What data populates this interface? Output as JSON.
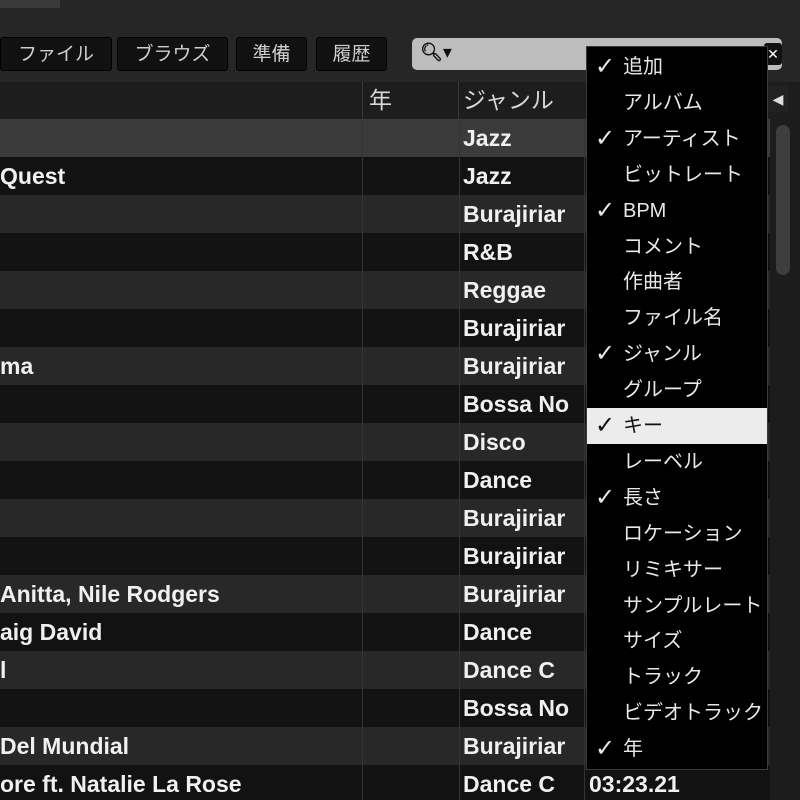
{
  "toolbar": {
    "buttons": [
      "ファイル",
      "ブラウズ",
      "準備",
      "履歴"
    ],
    "search": {
      "icon": "search-icon",
      "value": ""
    }
  },
  "columns": {
    "year": "年",
    "genre": "ジャンル"
  },
  "rows": [
    {
      "title": "",
      "genre": "Jazz",
      "length": ""
    },
    {
      "title": "Quest",
      "genre": "Jazz",
      "length": ""
    },
    {
      "title": "",
      "genre": "Burajiriar",
      "length": ""
    },
    {
      "title": "",
      "genre": "R&B",
      "length": ""
    },
    {
      "title": "",
      "genre": "Reggae",
      "length": ""
    },
    {
      "title": "",
      "genre": "Burajiriar",
      "length": ""
    },
    {
      "title": "ma",
      "genre": "Burajiriar",
      "length": ""
    },
    {
      "title": "",
      "genre": "Bossa No",
      "length": ""
    },
    {
      "title": "",
      "genre": "Disco",
      "length": ""
    },
    {
      "title": "",
      "genre": "Dance",
      "length": ""
    },
    {
      "title": "",
      "genre": "Burajiriar",
      "length": ""
    },
    {
      "title": "",
      "genre": "Burajiriar",
      "length": ""
    },
    {
      "title": "Anitta, Nile Rodgers",
      "genre": "Burajiriar",
      "length": ""
    },
    {
      "title": "aig David",
      "genre": "Dance",
      "length": ""
    },
    {
      "title": "l",
      "genre": "Dance C",
      "length": ""
    },
    {
      "title": "",
      "genre": "Bossa No",
      "length": ""
    },
    {
      "title": " Del Mundial",
      "genre": "Burajiriar",
      "length": ""
    },
    {
      "title": "ore ft. Natalie La Rose",
      "genre": "Dance C",
      "length": "03:23.21"
    }
  ],
  "menu": {
    "items": [
      {
        "label": "追加",
        "checked": true
      },
      {
        "label": "アルバム",
        "checked": false
      },
      {
        "label": "アーティスト",
        "checked": true
      },
      {
        "label": "ビットレート",
        "checked": false
      },
      {
        "label": "BPM",
        "checked": true
      },
      {
        "label": "コメント",
        "checked": false
      },
      {
        "label": "作曲者",
        "checked": false
      },
      {
        "label": "ファイル名",
        "checked": false
      },
      {
        "label": "ジャンル",
        "checked": true
      },
      {
        "label": "グループ",
        "checked": false
      },
      {
        "label": "キー",
        "checked": true,
        "highlighted": true
      },
      {
        "label": "レーベル",
        "checked": false
      },
      {
        "label": "長さ",
        "checked": true
      },
      {
        "label": "ロケーション",
        "checked": false
      },
      {
        "label": "リミキサー",
        "checked": false
      },
      {
        "label": "サンプルレート",
        "checked": false
      },
      {
        "label": "サイズ",
        "checked": false
      },
      {
        "label": "トラック",
        "checked": false
      },
      {
        "label": "ビデオトラック",
        "checked": false
      },
      {
        "label": "年",
        "checked": true
      }
    ]
  }
}
